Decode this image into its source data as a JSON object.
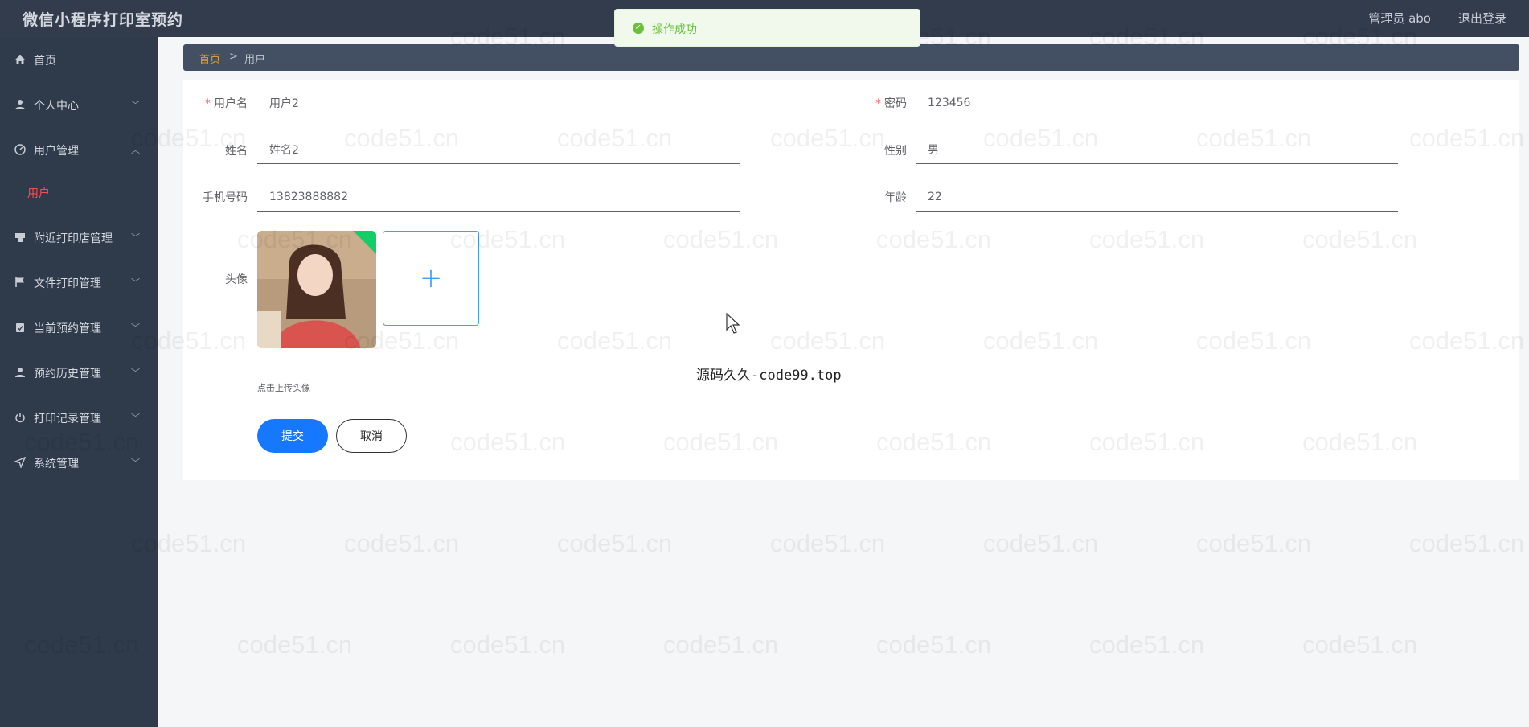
{
  "app": {
    "title": "微信小程序打印室预约"
  },
  "header": {
    "admin_label": "管理员 abo",
    "logout_label": "退出登录"
  },
  "toast": {
    "message": "操作成功",
    "color": "#67c23a"
  },
  "sidebar": {
    "items": [
      {
        "label": "首页",
        "icon": "home-icon"
      },
      {
        "label": "个人中心",
        "icon": "user-icon"
      },
      {
        "label": "用户管理",
        "icon": "gauge-icon",
        "expanded": true
      },
      {
        "label": "附近打印店管理",
        "icon": "printer-icon"
      },
      {
        "label": "文件打印管理",
        "icon": "flag-icon"
      },
      {
        "label": "当前预约管理",
        "icon": "clipboard-icon"
      },
      {
        "label": "预约历史管理",
        "icon": "user-icon"
      },
      {
        "label": "打印记录管理",
        "icon": "power-icon"
      },
      {
        "label": "系统管理",
        "icon": "send-icon"
      }
    ],
    "submenu": {
      "label": "用户",
      "active_color": "#ff4d4f"
    }
  },
  "breadcrumb": {
    "home": "首页",
    "separator": ">",
    "current": "用户"
  },
  "form": {
    "username": {
      "label": "用户名",
      "value": "用户2",
      "required": true
    },
    "password": {
      "label": "密码",
      "value": "123456",
      "required": true
    },
    "name": {
      "label": "姓名",
      "value": "姓名2"
    },
    "gender": {
      "label": "性别",
      "value": "男"
    },
    "phone": {
      "label": "手机号码",
      "value": "13823888882"
    },
    "age": {
      "label": "年龄",
      "value": "22"
    },
    "avatar": {
      "label": "头像",
      "hint": "点击上传头像"
    },
    "submit_label": "提交",
    "cancel_label": "取消"
  },
  "overlay": {
    "text": "源码久久-code99.top"
  },
  "watermark": {
    "text": "code51.cn"
  },
  "colors": {
    "topbar": "#333c4d",
    "sidebar": "#2f3a4a",
    "primary": "#1677ff",
    "breadcrumb_home": "#e6a23c"
  }
}
